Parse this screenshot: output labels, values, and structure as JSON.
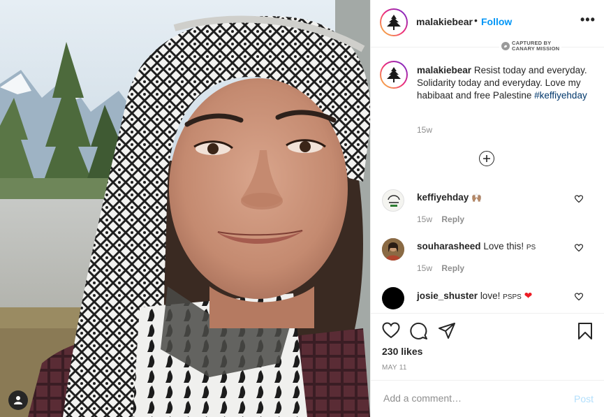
{
  "post": {
    "username": "malakiebear",
    "separator": "•",
    "follow_label": "Follow",
    "more_label": "•••",
    "watermark_line1": "CAPTURED BY",
    "watermark_line2": "CANARY MISSION",
    "caption_user": "malakiebear",
    "caption_text": "Resist today and everyday. Solidarity today and everyday. Love my habibaat and free Palestine",
    "caption_hashtag": "#keffiyehday",
    "caption_time": "15w",
    "likes": "230 likes",
    "date": "MAY 11"
  },
  "comments": [
    {
      "user": "keffiyehday",
      "text": "🙌🏽",
      "time": "15w",
      "reply": "Reply"
    },
    {
      "user": "souharasheed",
      "text": "Love this!",
      "suffix": "PS",
      "time": "15w",
      "reply": "Reply"
    },
    {
      "user": "josie_shuster",
      "text": "love!",
      "suffix": "PSPS",
      "emoji": "❤"
    }
  ],
  "comment_box": {
    "placeholder": "Add a comment…",
    "post_label": "Post"
  },
  "colors": {
    "accent": "#0095f6",
    "hashtag": "#00376b",
    "heart": "#ed4956"
  },
  "icons": [
    "user-tag-icon",
    "like-icon",
    "comment-icon",
    "share-icon",
    "save-icon",
    "load-more-icon",
    "heart-icon"
  ]
}
